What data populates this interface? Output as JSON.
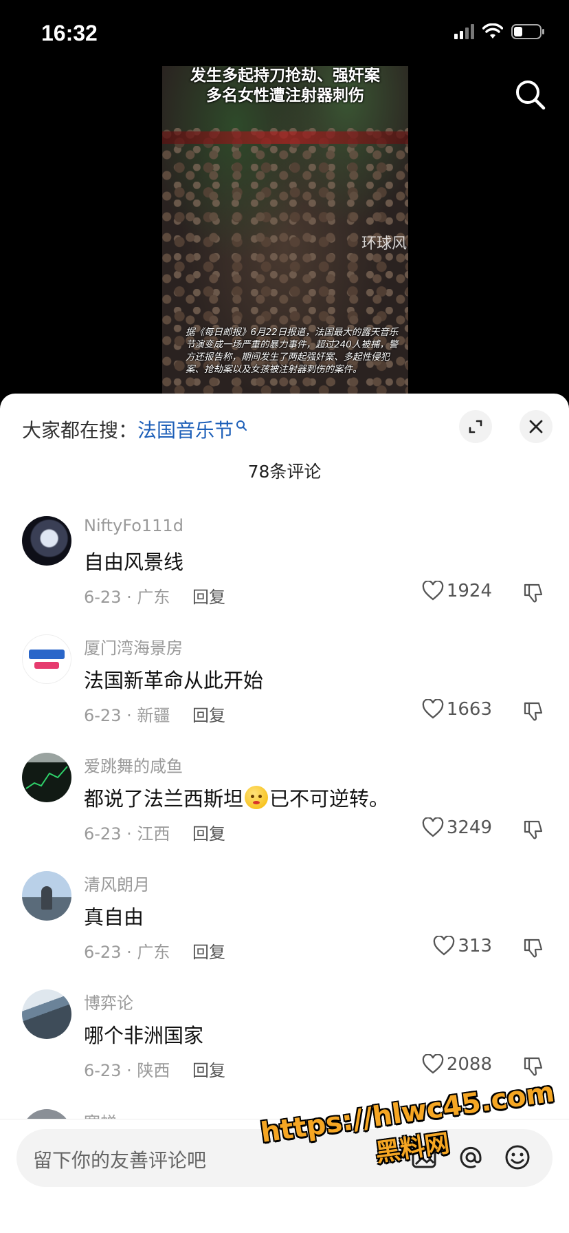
{
  "status_bar": {
    "time": "16:32"
  },
  "video": {
    "headline_lines": [
      "发生多起持刀抢劫、强奸案",
      "多名女性遭注射器刺伤"
    ],
    "watermark": "环球风",
    "caption": "据《每日邮报》6月22日报道，法国最大的露天音乐节演变成一场严重的暴力事件，超过240人被捕，警方还报告称，期间发生了两起强奸案、多起性侵犯案、抢劫案以及女孩被注射器刺伤的案件。"
  },
  "comments_panel": {
    "hot_search_label": "大家都在搜：",
    "hot_search_term": "法国音乐节",
    "count_label": "78条评论",
    "reply_label": "回复",
    "comments": [
      {
        "user": "NiftyFo111d",
        "text": "自由风景线",
        "meta": "6-23 · 广东",
        "likes": "1924",
        "avatar_color": "#3a3f55"
      },
      {
        "user": "厦门湾海景房",
        "text": "法国新革命从此开始",
        "meta": "6-23 · 新疆",
        "likes": "1663",
        "avatar_color": "#ffffff"
      },
      {
        "user": "爱跳舞的咸鱼",
        "text_before": "都说了法兰西斯坦",
        "text_after": "已不可逆转。",
        "emoji": "flushed-face",
        "meta": "6-23 · 江西",
        "likes": "3249",
        "avatar_color": "#1e2a22"
      },
      {
        "user": "清风朗月",
        "text": "真自由",
        "meta": "6-23 · 广东",
        "likes": "313",
        "avatar_color": "#6d8fb3"
      },
      {
        "user": "博弈论",
        "text": "哪个非洲国家",
        "meta": "6-23 · 陕西",
        "likes": "2088",
        "avatar_color": "#7f95a8"
      }
    ],
    "partial_user": "寒蝉"
  },
  "input": {
    "placeholder": "留下你的友善评论吧"
  },
  "overlay_watermark": {
    "url": "https://hlwc45.com",
    "brand": "黑料网"
  },
  "colors": {
    "accent_link": "#1d5fb8",
    "watermark": "#f5a623"
  }
}
